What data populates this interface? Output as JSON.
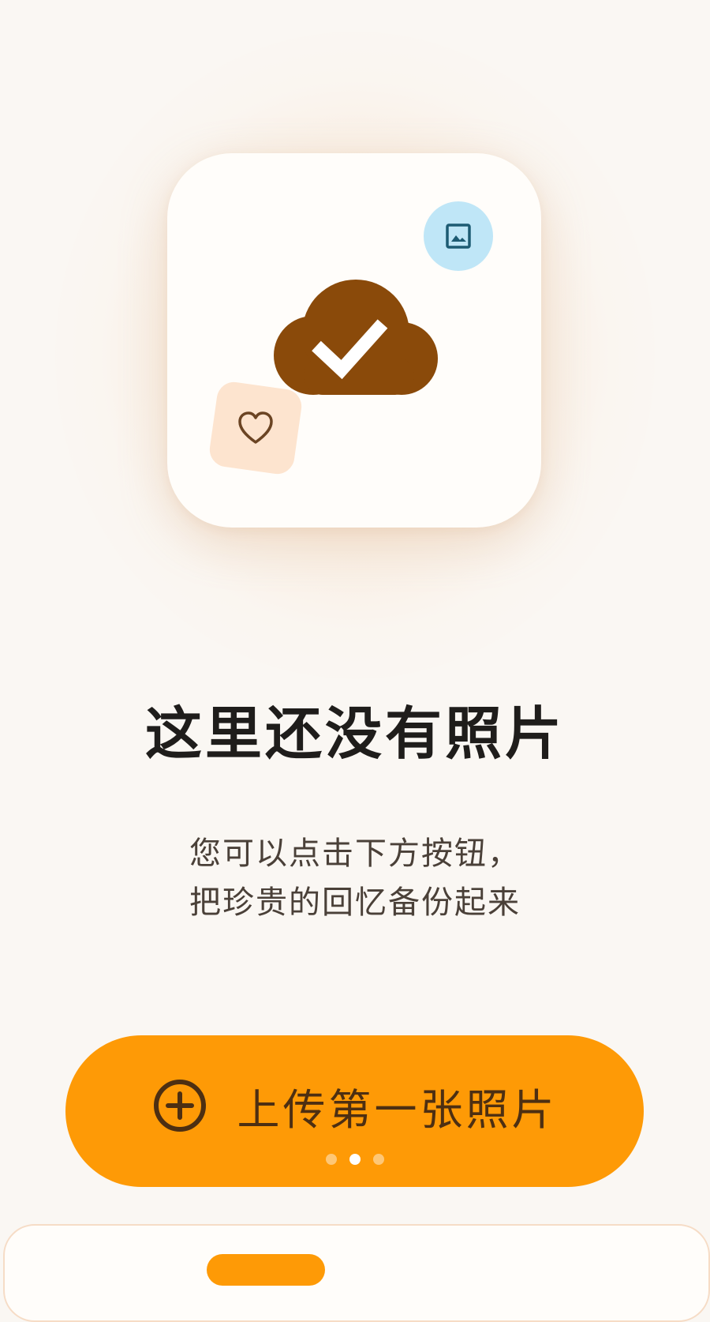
{
  "empty_state": {
    "title": "这里还没有照片",
    "description_line1": "您可以点击下方按钮，",
    "description_line2": "把珍贵的回忆备份起来"
  },
  "upload_button": {
    "label": "上传第一张照片",
    "icon": "plus-circle-icon"
  },
  "illustration": {
    "main_icon": "cloud-check-icon",
    "badges": [
      "image-icon",
      "heart-icon"
    ]
  },
  "pager": {
    "total": 3,
    "active_index": 1
  },
  "colors": {
    "background": "#faf7f3",
    "accent": "#fe9a06",
    "cloud": "#8a4a0a",
    "button_text": "#4d2f12",
    "image_badge": "#bfe6f7",
    "heart_badge": "#fde4cf"
  }
}
